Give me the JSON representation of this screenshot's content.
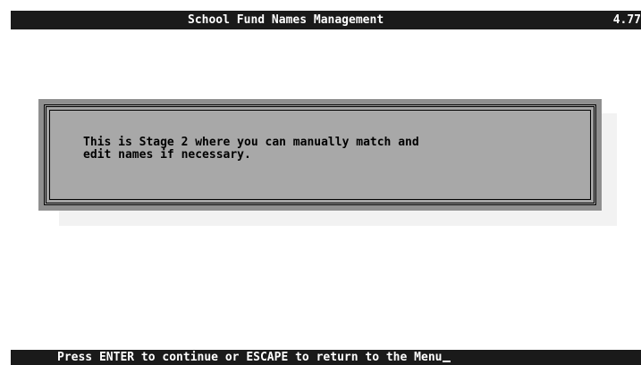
{
  "header": {
    "title": "School Fund Names Management",
    "version": "4.77"
  },
  "dialog": {
    "message": "This is Stage 2 where you can manually match and\nedit names if necessary."
  },
  "footer": {
    "prompt": "Press ENTER to continue or ESCAPE to return to the Menu"
  }
}
